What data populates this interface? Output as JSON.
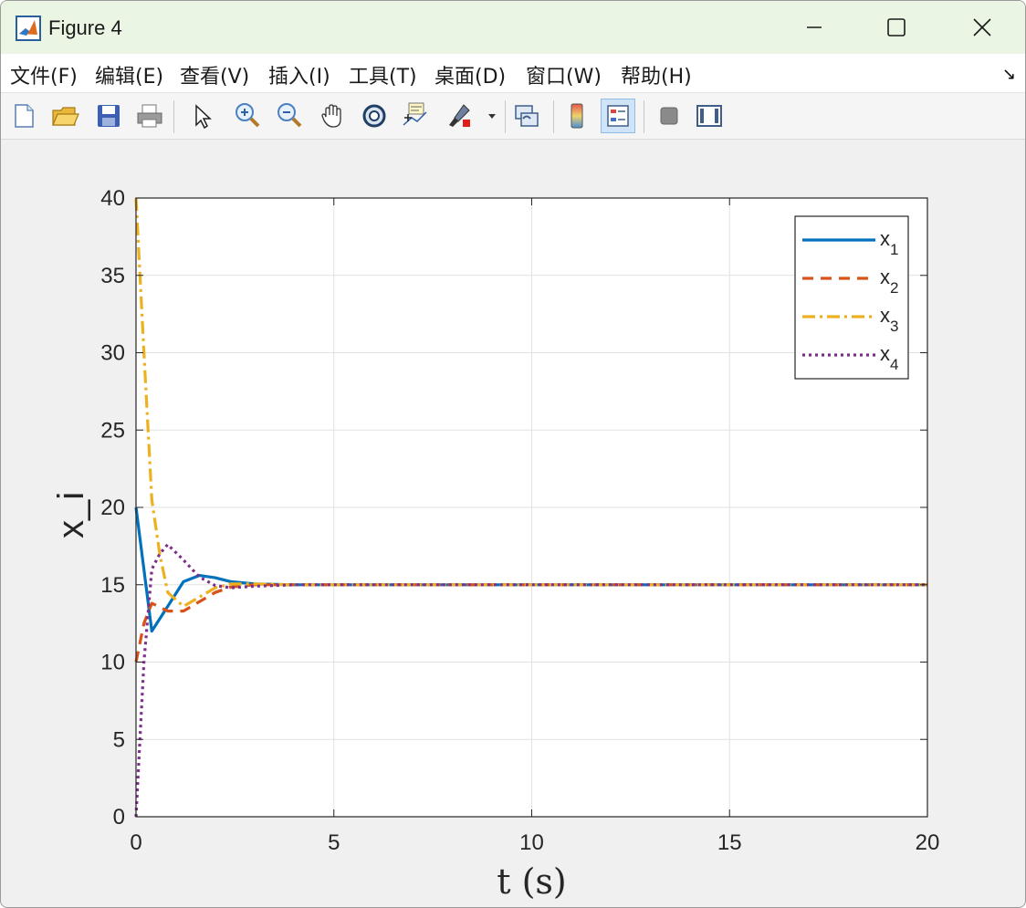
{
  "window": {
    "title": "Figure 4"
  },
  "menu": [
    "文件(F)",
    "编辑(E)",
    "查看(V)",
    "插入(I)",
    "工具(T)",
    "桌面(D)",
    "窗口(W)",
    "帮助(H)"
  ],
  "toolbar": [
    "new-figure-icon",
    "open-file-icon",
    "save-icon",
    "print-icon",
    "select-pointer-icon",
    "zoom-in-icon",
    "zoom-out-icon",
    "pan-hand-icon",
    "rotate-3d-icon",
    "data-cursor-icon",
    "brush-icon",
    "link-plot-icon",
    "colorbar-icon",
    "legend-icon",
    "hide-plot-tools-icon",
    "show-plot-tools-icon"
  ],
  "chart_data": {
    "type": "line",
    "title": "",
    "xlabel": "t (s)",
    "ylabel": "x_i",
    "xlim": [
      0,
      20
    ],
    "ylim": [
      0,
      40
    ],
    "xticks": [
      0,
      5,
      10,
      15,
      20
    ],
    "yticks": [
      0,
      5,
      10,
      15,
      20,
      25,
      30,
      35,
      40
    ],
    "grid": true,
    "legend": "top-right",
    "series": [
      {
        "name": "x",
        "subscript": "1",
        "color": "#0072BD",
        "style": "solid",
        "x": [
          0,
          0.4,
          0.8,
          1.2,
          1.6,
          2.0,
          2.4,
          3.0,
          4.0,
          20
        ],
        "y": [
          20,
          12,
          13.6,
          15.2,
          15.6,
          15.45,
          15.2,
          15.05,
          15.0,
          15.0
        ]
      },
      {
        "name": "x",
        "subscript": "2",
        "color": "#D95319",
        "style": "dashed",
        "x": [
          0,
          0.2,
          0.4,
          0.8,
          1.2,
          1.6,
          2.0,
          2.4,
          3.0,
          4.0,
          20
        ],
        "y": [
          10,
          12.5,
          13.8,
          13.3,
          13.3,
          13.9,
          14.5,
          14.85,
          15.0,
          15.0,
          15.0
        ]
      },
      {
        "name": "x",
        "subscript": "3",
        "color": "#EDB120",
        "style": "dashdot",
        "x": [
          0,
          0.2,
          0.4,
          0.6,
          0.8,
          1.2,
          1.6,
          2.0,
          2.4,
          3.0,
          4.0,
          20
        ],
        "y": [
          40,
          30,
          20.5,
          17,
          14.5,
          13.6,
          14.2,
          14.8,
          15.05,
          15.05,
          15.0,
          15.0
        ]
      },
      {
        "name": "x",
        "subscript": "4",
        "color": "#7E2F8E",
        "style": "dotted",
        "x": [
          0,
          0.1,
          0.2,
          0.4,
          0.6,
          0.8,
          1.2,
          1.6,
          2.0,
          2.4,
          3.0,
          4.0,
          20
        ],
        "y": [
          0,
          5,
          10,
          16,
          17,
          17.6,
          16.6,
          15.5,
          14.95,
          14.8,
          14.9,
          15.0,
          15.0
        ]
      }
    ]
  }
}
